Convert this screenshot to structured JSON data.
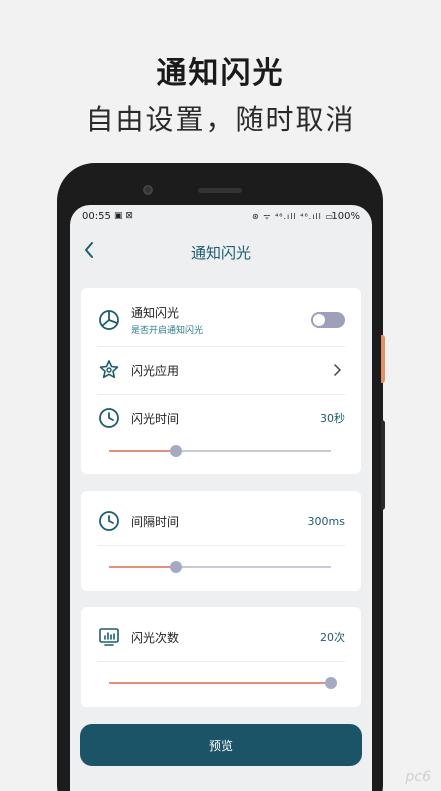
{
  "promo": {
    "title": "通知闪光",
    "subtitle": "自由设置，随时取消"
  },
  "status_bar": {
    "time": "00:55",
    "left_icons": "▣ ⊠",
    "right_icons": "⊛ ᯤ ⁴⁶.ıll ⁴⁶.ıll ▭",
    "battery": "100%"
  },
  "navbar": {
    "title": "通知闪光",
    "back_icon": "chevron-left-icon"
  },
  "card1": {
    "notify": {
      "label": "通知闪光",
      "sublabel": "是否开启通知闪光",
      "enabled": false,
      "icon": "pie-chart-icon"
    },
    "apps": {
      "label": "闪光应用",
      "icon": "star-badge-icon"
    },
    "flash_time": {
      "label": "闪光时间",
      "value": "30秒",
      "slider_fraction": 0.3,
      "icon": "clock-icon"
    }
  },
  "card2": {
    "interval": {
      "label": "间隔时间",
      "value": "300ms",
      "slider_fraction": 0.3,
      "icon": "clock-icon"
    }
  },
  "card3": {
    "count": {
      "label": "闪光次数",
      "value": "20次",
      "slider_fraction": 1.0,
      "icon": "monitor-chart-icon"
    }
  },
  "preview_button": {
    "label": "预览"
  },
  "colors": {
    "accent": "#1c5467",
    "slider_fill": "#e2907d",
    "slider_thumb": "#a6a9c2"
  },
  "watermark": "pc6"
}
